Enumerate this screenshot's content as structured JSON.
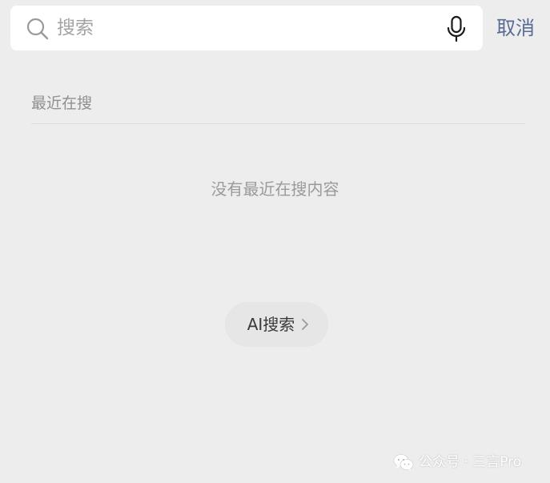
{
  "search": {
    "placeholder": "搜索",
    "value": ""
  },
  "header": {
    "cancel_label": "取消"
  },
  "recent": {
    "title": "最近在搜",
    "empty_message": "没有最近在搜内容"
  },
  "ai_search": {
    "label": "AI搜索"
  },
  "watermark": {
    "text": "公众号 · 三言Pro"
  },
  "colors": {
    "background": "#ededed",
    "accent": "#576b95",
    "search_bg": "#ffffff"
  },
  "icons": {
    "search": "search-icon",
    "mic": "microphone-icon",
    "chevron": "chevron-right-icon",
    "wechat": "wechat-icon"
  }
}
